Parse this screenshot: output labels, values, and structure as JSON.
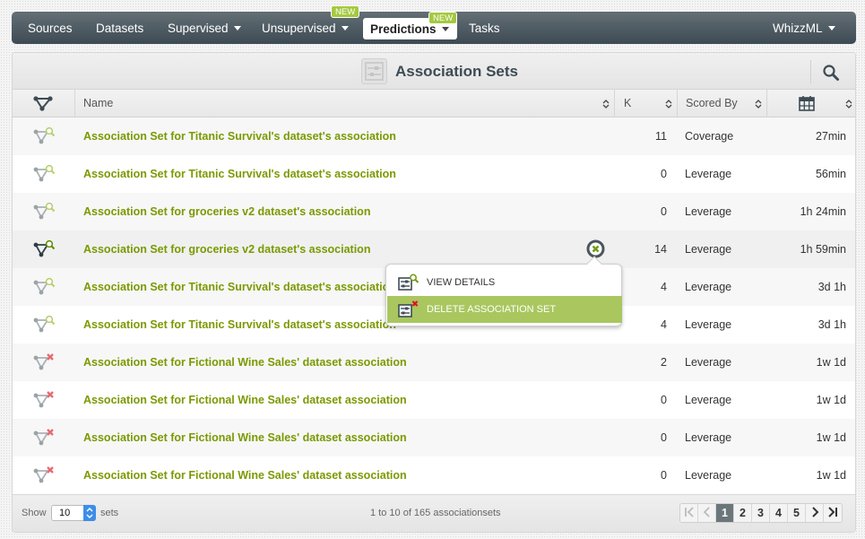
{
  "nav": {
    "items": [
      {
        "label": "Sources",
        "dropdown": false
      },
      {
        "label": "Datasets",
        "dropdown": false
      },
      {
        "label": "Supervised",
        "dropdown": true
      },
      {
        "label": "Unsupervised",
        "dropdown": true,
        "badge": "NEW"
      },
      {
        "label": "Predictions",
        "dropdown": true,
        "badge": "NEW",
        "active": true
      },
      {
        "label": "Tasks",
        "dropdown": false
      }
    ],
    "right": {
      "label": "WhizzML",
      "dropdown": true
    }
  },
  "panel": {
    "title": "Association Sets",
    "title_icon": "association-set-icon",
    "search_icon": "search-icon"
  },
  "table": {
    "columns": [
      {
        "label": "",
        "icon": "association-icon"
      },
      {
        "label": "Name"
      },
      {
        "label": "K"
      },
      {
        "label": "Scored By"
      },
      {
        "label": "",
        "icon": "calendar-icon"
      }
    ],
    "rows": [
      {
        "name": "Association Set for Titanic Survival's dataset's association",
        "k": "11",
        "scored_by": "Coverage",
        "age": "27min",
        "status": "ok"
      },
      {
        "name": "Association Set for Titanic Survival's dataset's association",
        "k": "0",
        "scored_by": "Leverage",
        "age": "56min",
        "status": "ok"
      },
      {
        "name": "Association Set for groceries v2 dataset's association",
        "k": "0",
        "scored_by": "Leverage",
        "age": "1h 24min",
        "status": "ok"
      },
      {
        "name": "Association Set for groceries v2 dataset's association",
        "k": "14",
        "scored_by": "Leverage",
        "age": "1h 59min",
        "status": "ok",
        "hover": true
      },
      {
        "name": "Association Set for Titanic Survival's dataset's association",
        "k": "4",
        "scored_by": "Leverage",
        "age": "3d 1h",
        "status": "ok"
      },
      {
        "name": "Association Set for Titanic Survival's dataset's association",
        "k": "4",
        "scored_by": "Leverage",
        "age": "3d 1h",
        "status": "ok"
      },
      {
        "name": "Association Set for Fictional Wine Sales' dataset association",
        "k": "2",
        "scored_by": "Leverage",
        "age": "1w 1d",
        "status": "error"
      },
      {
        "name": "Association Set for Fictional Wine Sales' dataset association",
        "k": "0",
        "scored_by": "Leverage",
        "age": "1w 1d",
        "status": "error"
      },
      {
        "name": "Association Set for Fictional Wine Sales' dataset association",
        "k": "0",
        "scored_by": "Leverage",
        "age": "1w 1d",
        "status": "error"
      },
      {
        "name": "Association Set for Fictional Wine Sales' dataset association",
        "k": "0",
        "scored_by": "Leverage",
        "age": "1w 1d",
        "status": "error"
      }
    ]
  },
  "context_menu": {
    "items": [
      {
        "label": "VIEW DETAILS",
        "icon": "view-details-icon"
      },
      {
        "label": "DELETE ASSOCIATION SET",
        "icon": "delete-icon",
        "highlighted": true
      }
    ]
  },
  "footer": {
    "show_label": "Show",
    "page_size": "10",
    "sets_label": "sets",
    "info": "1 to 10 of 165 associationsets",
    "pages": [
      "1",
      "2",
      "3",
      "4",
      "5"
    ],
    "current_page": "1"
  },
  "colors": {
    "accent_green": "#a5c940",
    "link_green": "#7a9a01",
    "nav_dark": "#3d4b54",
    "menu_highlight": "#a9c75e",
    "error_red": "#e0404a"
  }
}
